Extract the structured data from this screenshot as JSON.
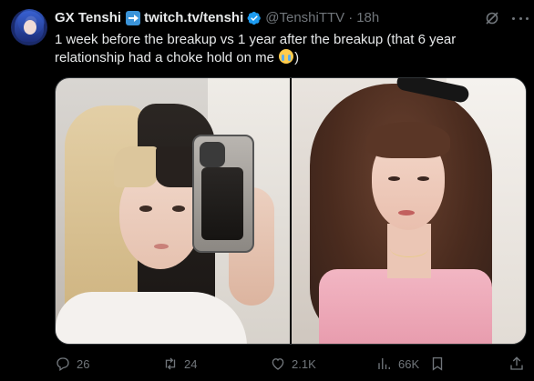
{
  "author": {
    "display_name": "GX Tenshi",
    "display_name_link": "twitch.tv/tenshi",
    "handle": "@TenshiTTV",
    "separator": "·",
    "time": "18h"
  },
  "tweet": {
    "text": "1 week before the breakup vs 1 year after the breakup (that 6 year relationship had a choke hold on me",
    "text_suffix": ")"
  },
  "actions": {
    "replies": "26",
    "retweets": "24",
    "likes": "2.1K",
    "views": "66K"
  },
  "icons": {
    "reply": "reply-icon",
    "retweet": "retweet-icon",
    "like": "heart-icon",
    "views": "views-icon",
    "bookmark": "bookmark-icon",
    "share": "share-icon",
    "grok": "grok-icon",
    "more": "more-icon",
    "verified": "verified-icon"
  },
  "colors": {
    "background": "#000000",
    "text": "#e7e9ea",
    "muted": "#71767b",
    "verified": "#1d9bf0"
  }
}
